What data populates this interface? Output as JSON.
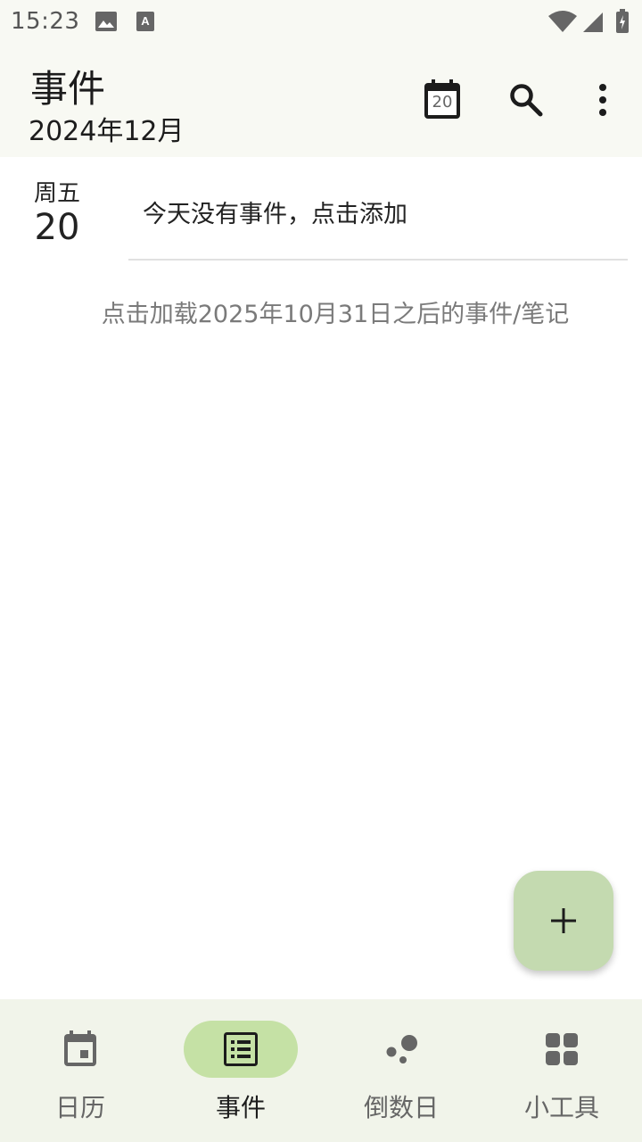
{
  "status_bar": {
    "time": "15:23"
  },
  "app_bar": {
    "title": "事件",
    "subtitle": "2024年12月",
    "calendar_day": "20",
    "icons": [
      "calendar-today-icon",
      "search-icon",
      "more-vert-icon"
    ]
  },
  "day": {
    "weekday": "周五",
    "date": "20",
    "empty_text": "今天没有事件，点击添加"
  },
  "load_more": "点击加载2025年10月31日之后的事件/笔记",
  "fab": {
    "icon": "add-icon"
  },
  "nav": {
    "items": [
      {
        "label": "日历",
        "icon": "calendar-icon"
      },
      {
        "label": "事件",
        "icon": "list-icon",
        "active": true
      },
      {
        "label": "倒数日",
        "icon": "bubbles-icon"
      },
      {
        "label": "小工具",
        "icon": "widgets-icon"
      }
    ]
  },
  "colors": {
    "accent": "#c5e1a5",
    "fab": "#c4dab0",
    "bar_bg": "#f8f9f3",
    "nav_bg": "#f1f4ea"
  }
}
